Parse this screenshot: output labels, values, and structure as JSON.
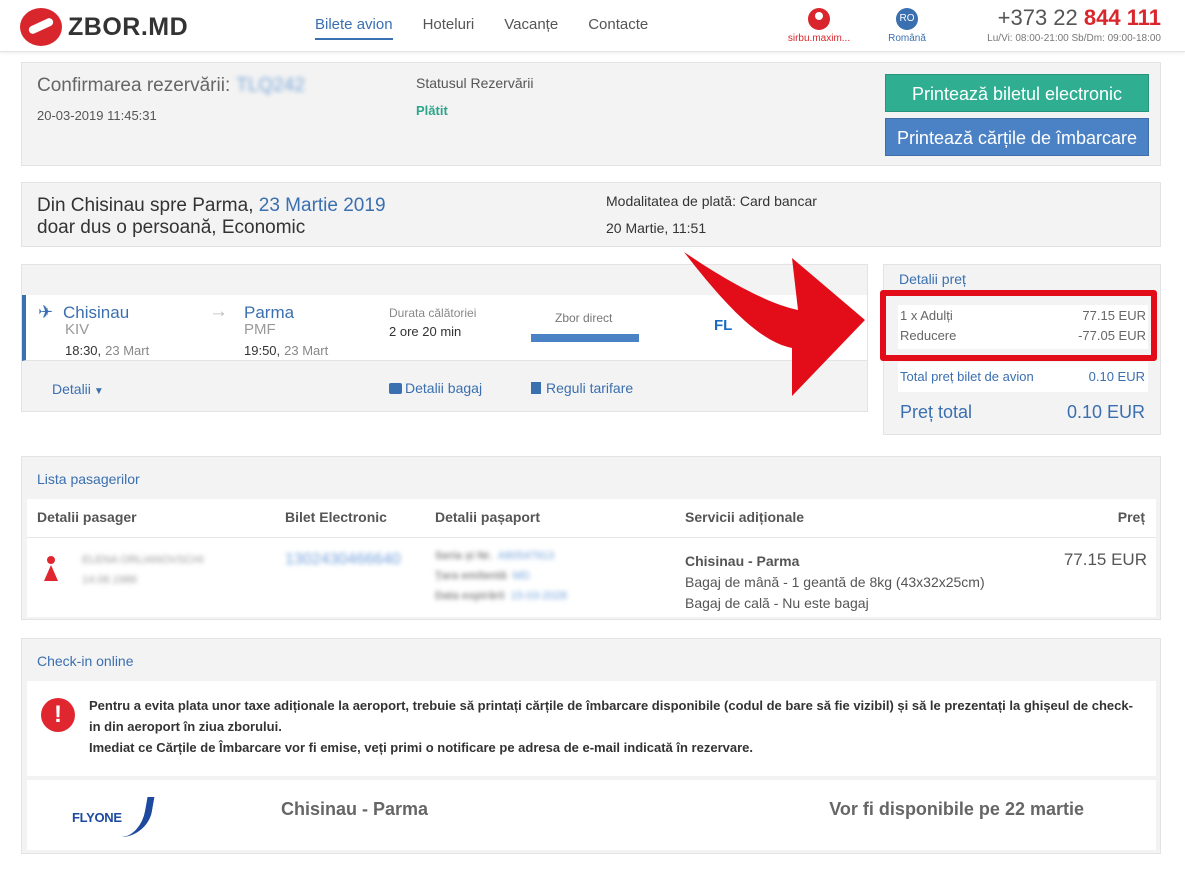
{
  "header": {
    "logo_text": "ZBOR.MD",
    "nav": [
      "Bilete avion",
      "Hoteluri",
      "Vacanțe",
      "Contacte"
    ],
    "user_name": "sirbu.maxim...",
    "lang_code": "RO",
    "lang_name": "Română",
    "phone_prefix": "+373 22",
    "phone_number": "844 111",
    "hours": "Lu/Vi: 08:00-21:00 Sb/Dm: 09:00-18:00"
  },
  "confirm": {
    "title": "Confirmarea rezervării:",
    "code": "TLQ242",
    "datetime": "20-03-2019 11:45:31",
    "status_label": "Statusul Rezervării",
    "status_value": "Plătit",
    "btn_ticket": "Printează biletul electronic",
    "btn_boarding": "Printează cărțile de îmbarcare"
  },
  "route": {
    "prefix": "Din Chisinau spre Parma,",
    "date": "23 Martie 2019",
    "line2": "doar dus o persoană, Economic",
    "payment_method": "Modalitatea de plată: Card bancar",
    "payment_date": "20 Martie, 11:51"
  },
  "flight": {
    "dep_city": "Chisinau",
    "dep_code": "KIV",
    "dep_time": "18:30,",
    "dep_date": "23 Mart",
    "arr_city": "Parma",
    "arr_code": "PMF",
    "arr_time": "19:50,",
    "arr_date": "23 Mart",
    "duration_label": "Durata călătoriei",
    "duration_value": "2 ore 20 min",
    "direct_label": "Zbor direct",
    "carrier_mark": "FL",
    "details_link": "Detalii",
    "baggage_link": "Detalii bagaj",
    "rules_link": "Reguli tarifare"
  },
  "price": {
    "title": "Detalii preț",
    "rows": [
      {
        "label": "1 x Adulți",
        "value": "77.15 EUR"
      },
      {
        "label": "Reducere",
        "value": "-77.05 EUR"
      }
    ],
    "ticket_total_label": "Total preț bilet de avion",
    "ticket_total_value": "0.10 EUR",
    "total_label": "Preț total",
    "total_value": "0.10 EUR"
  },
  "passengers": {
    "title": "Lista pasagerilor",
    "headers": [
      "Detalii pasager",
      "Bilet Electronic",
      "Detalii pașaport",
      "Servicii adiționale",
      "Preț"
    ],
    "row": {
      "name": "ELENA ORLIANOVSCHI",
      "dob": "14.08.1986",
      "ticket": "1302430466640",
      "passport": [
        {
          "label": "Seria și Nr.",
          "value": "A80547913"
        },
        {
          "label": "Țara emitentă",
          "value": "MD"
        },
        {
          "label": "Data expirării",
          "value": "15-03-2028"
        }
      ],
      "service_route": "Chisinau - Parma",
      "service_hand": "Bagaj de mână - 1 geantă de 8kg (43x32x25cm)",
      "service_hold": "Bagaj de cală - Nu este bagaj",
      "price": "77.15 EUR"
    }
  },
  "checkin": {
    "title": "Check-in online",
    "notice_1": "Pentru a evita plata unor taxe adiționale la aeroport, trebuie să printați cărțile de îmbarcare disponibile (codul de bare să fie vizibil) și să le prezentați la ghișeul de check-in din aeroport în ziua zborului.",
    "notice_2": "Imediat ce Cărțile de Îmbarcare vor fi emise, veți primi o notificare pe adresa de e-mail indicată în rezervare.",
    "warn_glyph": "!",
    "carrier_logo_text": "FLYONE",
    "route": "Chisinau - Parma",
    "availability": "Vor fi disponibile pe 22 martie"
  },
  "colors": {
    "brand_red": "#d9262c",
    "accent_blue": "#3a6fb0",
    "button_green": "#2fae91",
    "button_blue": "#4b82c6",
    "highlight_red": "#e20d18"
  },
  "icons": [
    "logo-icon",
    "user-icon",
    "plane-icon",
    "arrow-right-icon",
    "chevron-down-icon",
    "baggage-icon",
    "document-icon",
    "person-female-icon",
    "warning-icon",
    "red-pointer-arrow"
  ]
}
